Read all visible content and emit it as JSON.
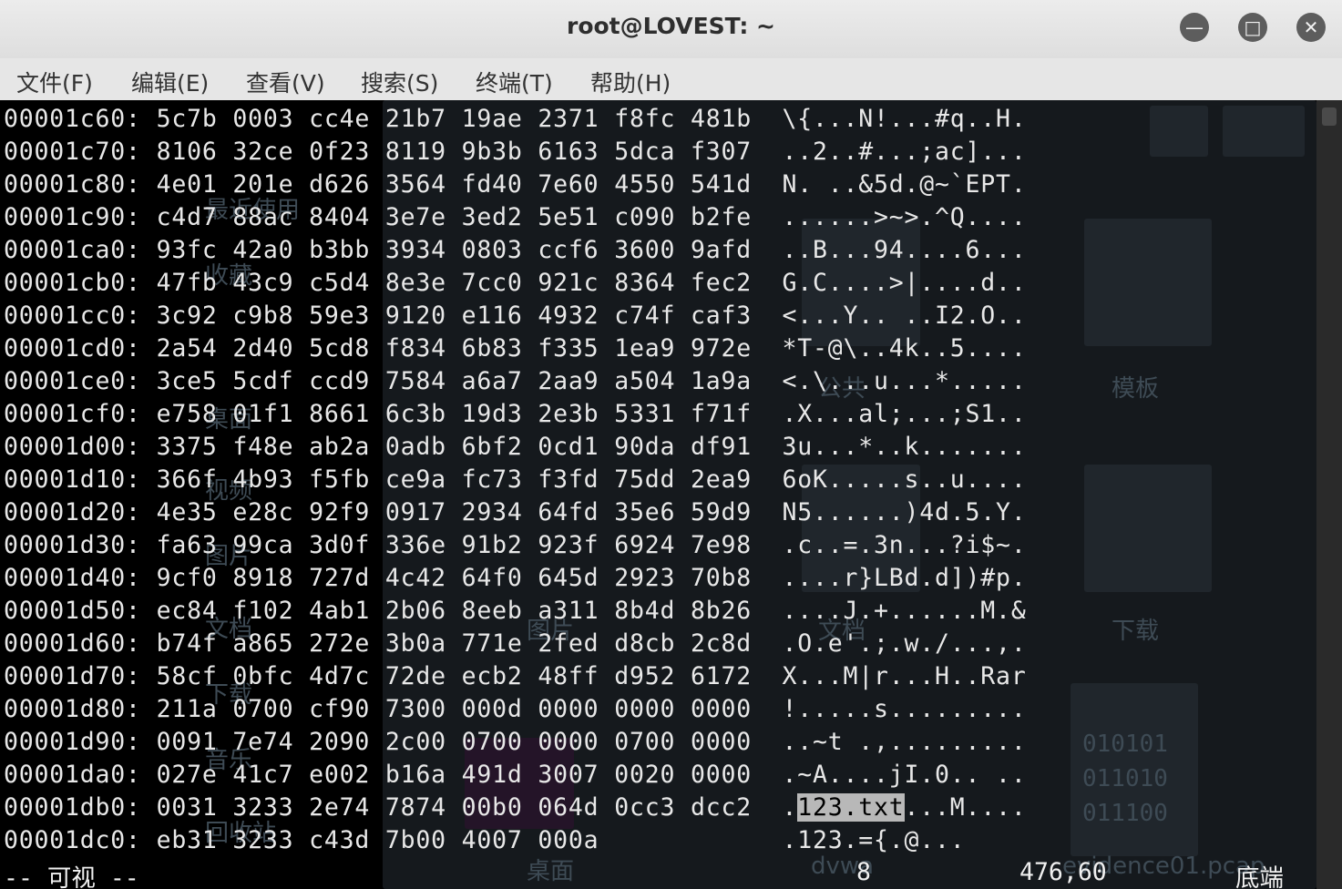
{
  "window": {
    "title": "root@LOVEST: ~",
    "controls": [
      "minimize",
      "maximize",
      "close"
    ]
  },
  "menu": [
    "文件(F)",
    "编辑(E)",
    "查看(V)",
    "搜索(S)",
    "终端(T)",
    "帮助(H)"
  ],
  "lines": [
    {
      "offset": "00001c60:",
      "hex": "5c7b 0003 cc4e 21b7 19ae 2371 f8fc 481b",
      "ascii": "\\{...N!...#q..H."
    },
    {
      "offset": "00001c70:",
      "hex": "8106 32ce 0f23 8119 9b3b 6163 5dca f307",
      "ascii": "..2..#...;ac]..."
    },
    {
      "offset": "00001c80:",
      "hex": "4e01 201e d626 3564 fd40 7e60 4550 541d",
      "ascii": "N. ..&5d.@~`EPT."
    },
    {
      "offset": "00001c90:",
      "hex": "c4d7 88ac 8404 3e7e 3ed2 5e51 c090 b2fe",
      "ascii": "......>~>.^Q...."
    },
    {
      "offset": "00001ca0:",
      "hex": "93fc 42a0 b3bb 3934 0803 ccf6 3600 9afd",
      "ascii": "..B...94....6..."
    },
    {
      "offset": "00001cb0:",
      "hex": "47fb 43c9 c5d4 8e3e 7cc0 921c 8364 fec2",
      "ascii": "G.C....>|....d.."
    },
    {
      "offset": "00001cc0:",
      "hex": "3c92 c9b8 59e3 9120 e116 4932 c74f caf3",
      "ascii": "<...Y.. ..I2.O.."
    },
    {
      "offset": "00001cd0:",
      "hex": "2a54 2d40 5cd8 f834 6b83 f335 1ea9 972e",
      "ascii": "*T-@\\..4k..5...."
    },
    {
      "offset": "00001ce0:",
      "hex": "3ce5 5cdf ccd9 7584 a6a7 2aa9 a504 1a9a",
      "ascii": "<.\\...u...*....."
    },
    {
      "offset": "00001cf0:",
      "hex": "e758 01f1 8661 6c3b 19d3 2e3b 5331 f71f",
      "ascii": ".X...al;...;S1.."
    },
    {
      "offset": "00001d00:",
      "hex": "3375 f48e ab2a 0adb 6bf2 0cd1 90da df91",
      "ascii": "3u...*..k......."
    },
    {
      "offset": "00001d10:",
      "hex": "366f 4b93 f5fb ce9a fc73 f3fd 75dd 2ea9",
      "ascii": "6oK.....s..u...."
    },
    {
      "offset": "00001d20:",
      "hex": "4e35 e28c 92f9 0917 2934 64fd 35e6 59d9",
      "ascii": "N5......)4d.5.Y."
    },
    {
      "offset": "00001d30:",
      "hex": "fa63 99ca 3d0f 336e 91b2 923f 6924 7e98",
      "ascii": ".c..=.3n...?i$~."
    },
    {
      "offset": "00001d40:",
      "hex": "9cf0 8918 727d 4c42 64f0 645d 2923 70b8",
      "ascii": "....r}LBd.d])#p."
    },
    {
      "offset": "00001d50:",
      "hex": "ec84 f102 4ab1 2b06 8eeb a311 8b4d 8b26",
      "ascii": "....J.+......M.&"
    },
    {
      "offset": "00001d60:",
      "hex": "b74f a865 272e 3b0a 771e 2fed d8cb 2c8d",
      "ascii": ".O.e'.;.w./...,."
    },
    {
      "offset": "00001d70:",
      "hex": "58cf 0bfc 4d7c 72de ecb2 48ff d952 6172",
      "ascii": "X...M|r...H..Rar"
    },
    {
      "offset": "00001d80:",
      "hex": "211a 0700 cf90 7300 000d 0000 0000 0000",
      "ascii": "!.....s........."
    },
    {
      "offset": "00001d90:",
      "hex": "0091 7e74 2090 2c00 0700 0000 0700 0000",
      "ascii": "..~t .,........."
    },
    {
      "offset": "00001da0:",
      "hex": "027e 41c7 e002 b16a 491d 3007 0020 0000",
      "ascii": ".~A....jI.0.. .."
    },
    {
      "offset": "00001db0:",
      "hex": "0031 3233 2e74 7874 00b0 064d 0cc3 dcc2",
      "ascii_pre": ".",
      "ascii_sel": "123.txt",
      "ascii_post": "...M...."
    },
    {
      "offset": "00001dc0:",
      "hex": "eb31 3233 c43d 7b00 4007 000a",
      "ascii": "          .123.={.@..."
    }
  ],
  "status": {
    "mode": "-- 可视 --",
    "count": "8",
    "position": "476,60",
    "scroll": "底端"
  },
  "background_ghost": {
    "labels": [
      "最近使用",
      "收藏",
      "桌面",
      "视频",
      "图片",
      "文档",
      "下载",
      "音乐",
      "回收站",
      "公共",
      "模板",
      "图片",
      "文档",
      "下载",
      "桌面",
      "dvwa",
      "evidence01.pcap"
    ],
    "binary_lines": [
      "010101",
      "011010",
      "011100"
    ]
  }
}
